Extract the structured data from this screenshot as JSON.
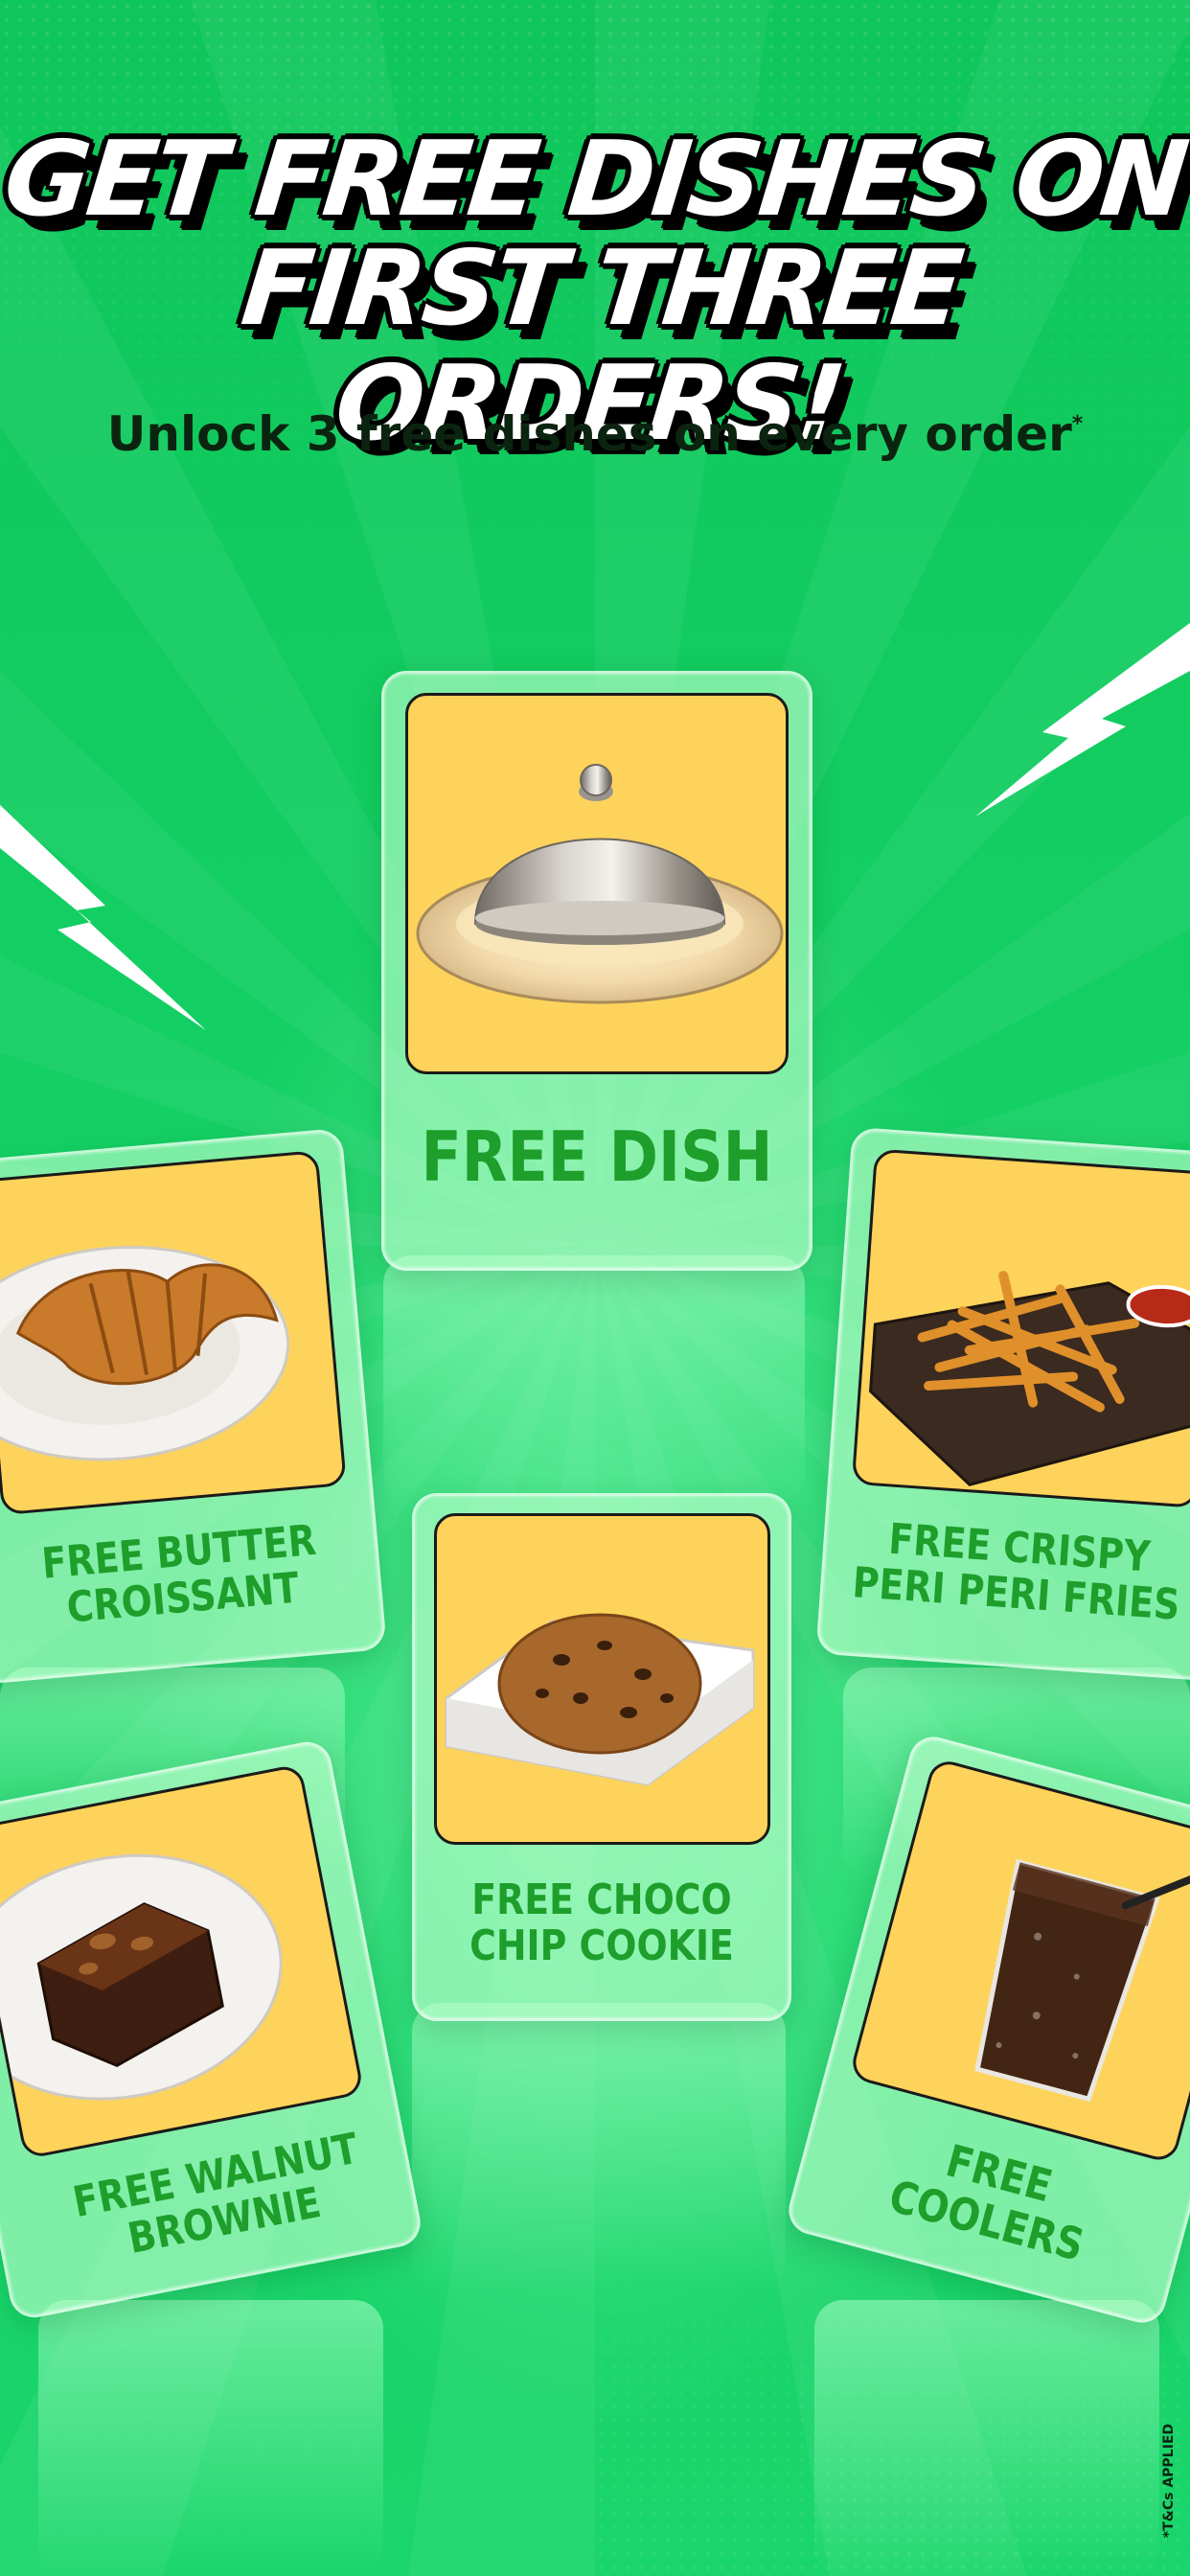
{
  "headline": {
    "line1": "GET FREE DISHES ON",
    "line2": "FIRST THREE ORDERS!"
  },
  "subtitle": {
    "text": "Unlock 3 free dishes on every order",
    "mark": "*"
  },
  "cards": {
    "center": {
      "label": "FREE DISH",
      "icon": "cloche-icon"
    },
    "left1": {
      "line1": "FREE BUTTER",
      "line2": "CROISSANT",
      "icon": "croissant-icon"
    },
    "right1": {
      "line1": "FREE CRISPY",
      "line2": "PERI PERI FRIES",
      "icon": "fries-icon"
    },
    "middle": {
      "line1": "FREE CHOCO",
      "line2": "CHIP COOKIE",
      "icon": "cookie-icon"
    },
    "left2": {
      "line1": "FREE WALNUT",
      "line2": "BROWNIE",
      "icon": "brownie-icon"
    },
    "right2": {
      "line1": "FREE",
      "line2": "COOLERS",
      "icon": "cold-drink-icon"
    }
  },
  "footnote": "*T&Cs APPLIED",
  "colors": {
    "background": "#12c95e",
    "panel": "#fdd35b",
    "label": "#1e9e2b"
  }
}
